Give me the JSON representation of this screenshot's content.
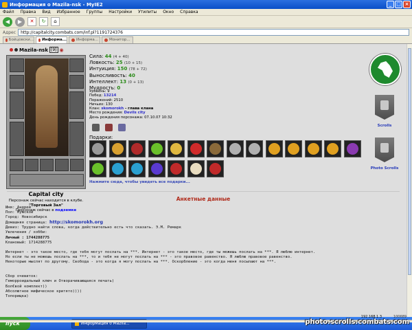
{
  "window": {
    "title": "Информация о Mazila-nsk - MyIE2"
  },
  "menu": [
    "Файл",
    "Правка",
    "Вид",
    "Избранное",
    "Группы",
    "Настройки",
    "Утилиты",
    "Окно",
    "Справка"
  ],
  "address": {
    "label": "Адрес",
    "url": "http://capitalcity.combats.com/inf.pl?1191724376"
  },
  "tabs": [
    {
      "label": "Бойцовски..."
    },
    {
      "label": "Информа..."
    },
    {
      "label": "Информа..."
    },
    {
      "label": "Монитор..."
    }
  ],
  "character": {
    "name": "Mazila-nsk",
    "level": "[9]",
    "city": "Capital city",
    "club_line": "Персонаж сейчас находится в клубе.",
    "location": "\"Торговый Зал\"",
    "status_prefix": "Персонаж сейчас в ",
    "status_value": "подземке"
  },
  "stats": [
    {
      "label": "Сила:",
      "value": "44",
      "extra": "(4 + 40)"
    },
    {
      "label": "Ловкость:",
      "value": "25",
      "extra": "(10 + 15)"
    },
    {
      "label": "Интуиция:",
      "value": "150",
      "extra": "(78 + 72)"
    },
    {
      "label": "Выносливость:",
      "value": "40",
      "extra": ""
    },
    {
      "label": "Интеллект:",
      "value": "13",
      "extra": "(0 + 13)"
    },
    {
      "label": "Мудрость:",
      "value": "0",
      "extra": ""
    }
  ],
  "info": {
    "level": "Уровень: 9",
    "wins_label": "Побед: ",
    "wins": "13214",
    "losses": "Поражений: 2510",
    "draws": "Ничьих: 130",
    "clan_label": "Клан: ",
    "clan": "skomorokh",
    "clan_rank": " - глава клана",
    "birthplace_label": "Место рождения: ",
    "birthplace": "Devils city",
    "birthday": "День рождения персонажа: 07.10.07 10:32"
  },
  "gifts": {
    "title": "Подарки:",
    "link": "Нажмите сюда, чтобы увидеть все подарки...",
    "items": [
      {
        "icon": "crossed-swords-icon",
        "color": "#9a9a9a"
      },
      {
        "icon": "flower-bouquet-icon",
        "color": "#d8a030"
      },
      {
        "icon": "red-book-icon",
        "color": "#b02a2a"
      },
      {
        "icon": "green-ring-icon",
        "color": "#6ac02a"
      },
      {
        "icon": "gold-ring-icon",
        "color": "#e0b840"
      },
      {
        "icon": "jester-hat-icon",
        "color": "#d02a2a"
      },
      {
        "icon": "cauldron-icon",
        "color": "#8a6a3a"
      },
      {
        "icon": "crossed-swords-icon",
        "color": "#b0b0b0"
      },
      {
        "icon": "crossed-swords-icon",
        "color": "#b0b0b0"
      },
      {
        "icon": "crescent-moon-icon",
        "color": "#e0a020"
      },
      {
        "icon": "crescent-moon-icon",
        "color": "#e0a020"
      },
      {
        "icon": "crescent-moon-icon",
        "color": "#e0a020"
      },
      {
        "icon": "crescent-moon-icon",
        "color": "#e0a020"
      },
      {
        "icon": "grapes-icon",
        "color": "#8a3ab0"
      },
      {
        "icon": "green-ring-icon",
        "color": "#6ac02a"
      },
      {
        "icon": "blue-mushroom-icon",
        "color": "#2aa0d0"
      },
      {
        "icon": "blue-mushroom-icon",
        "color": "#2aa0d0"
      },
      {
        "icon": "purple-hat-icon",
        "color": "#5a3ad0"
      },
      {
        "icon": "red-card-icon",
        "color": "#c02a2a"
      },
      {
        "icon": "skeleton-icon",
        "color": "#e8dcc0"
      },
      {
        "icon": "red-card-icon",
        "color": "#c02a2a"
      }
    ]
  },
  "clan_panel": {
    "scrolls_label": "Scrolls",
    "photo_label": "Photo Scrolls"
  },
  "profile": {
    "title": "Анкетные данные",
    "name": "Имя: Андрей",
    "sex": "Пол: Мужской",
    "city": "Город: Новосибирск",
    "homepage_label": "Домашняя страница: ",
    "homepage": "http://skomorokh.org",
    "motto": "Девиз: Трудно найти слова, когда действительно есть что сказать. Э.М. Ремарк",
    "hobby": "Увлечения / хобби:",
    "personal": "Личный : 1744288775",
    "clan_icq": "Клановый: 1714288775",
    "text1": "Интернет - это такое место, где тебя могут послать на ***. Интернет - это такое место, где ты можешь послать на ***. Я люблю интернет.",
    "text2": "Но если ты не можешь послать на ***, то и тебя не могут послать на *** - это правовое равенство. Я люблю правовое равенство.",
    "text3": "Некоторые мыслят по другому. Свобода - это когда я могу послать на ***. Оскорбление - это когда меня посылают на ***.",
    "list_title": "Сбор очевиток:",
    "list1": "Геморроидальный ключ и Отворачивающаяся печать)",
    "list2": "Бол€вой комплект))",
    "list3": "Абсолютное мифическое критято))))",
    "list4": "Топорищка)"
  },
  "status": {
    "ip": "192.168.1.3",
    "mem": "100689"
  },
  "taskbar": {
    "start": "пуск",
    "task": "Информация о Mazila..."
  },
  "watermark": "photo.scrolls.combats.com"
}
